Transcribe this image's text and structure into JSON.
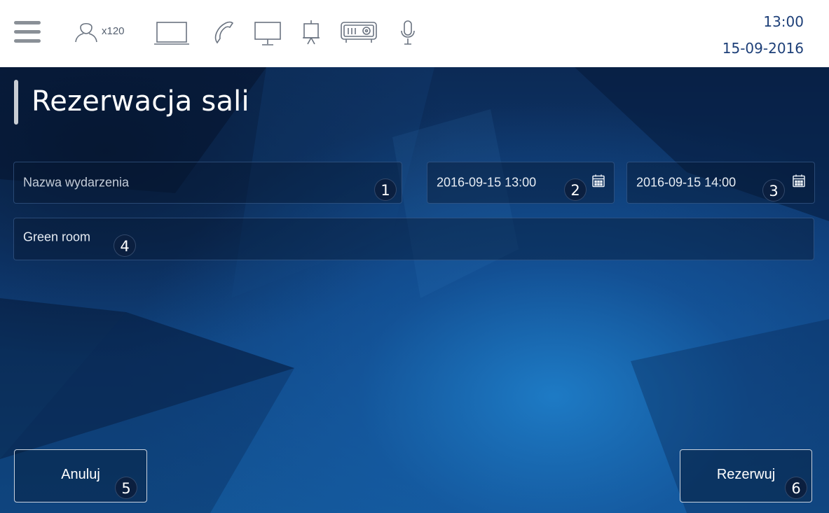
{
  "topbar": {
    "icons": [
      "menu-icon",
      "user-icon",
      "laptop-icon",
      "phone-icon",
      "monitor-icon",
      "flipchart-icon",
      "projector-icon",
      "microphone-icon"
    ],
    "attendees_count": "x120",
    "time": "13:00",
    "date": "15-09-2016"
  },
  "page": {
    "title": "Rezerwacja sali"
  },
  "form": {
    "event_name": {
      "value": "",
      "placeholder": "Nazwa wydarzenia",
      "badge": "1"
    },
    "start": {
      "value": "2016-09-15 13:00",
      "badge": "2",
      "icon": "calendar-icon"
    },
    "end": {
      "value": "2016-09-15 14:00",
      "badge": "3",
      "icon": "calendar-icon"
    },
    "room": {
      "value": "Green room",
      "badge": "4"
    }
  },
  "buttons": {
    "cancel": {
      "label": "Anuluj",
      "badge": "5"
    },
    "reserve": {
      "label": "Rezerwuj",
      "badge": "6"
    }
  },
  "colors": {
    "accent": "#1d3f78",
    "panel_dark": "#0c2a55",
    "panel_light": "#1e7dc8",
    "badge": "#0b1f3f"
  }
}
